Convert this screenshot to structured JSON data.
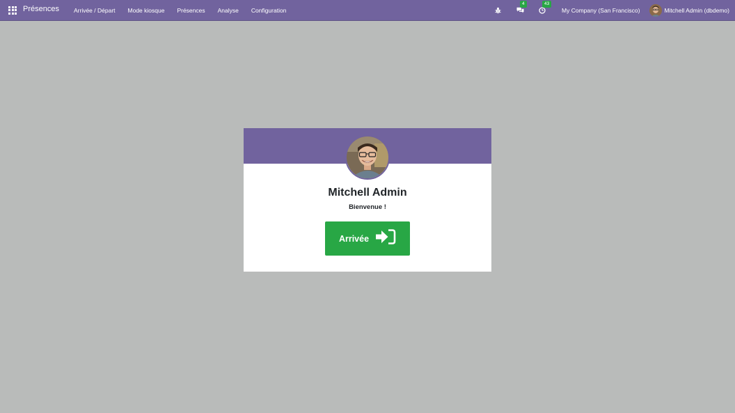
{
  "navbar": {
    "brand": "Présences",
    "menu": [
      {
        "label": "Arrivée / Départ"
      },
      {
        "label": "Mode kiosque"
      },
      {
        "label": "Présences"
      },
      {
        "label": "Analyse"
      },
      {
        "label": "Configuration"
      }
    ],
    "icons": {
      "debug": "bug-icon",
      "messages": "chat-icon",
      "activities": "clock-icon"
    },
    "messages_badge": "4",
    "activities_badge": "43",
    "company": "My Company (San Francisco)",
    "user_name": "Mitchell Admin (dbdemo)"
  },
  "card": {
    "employee_name": "Mitchell Admin",
    "welcome": "Bienvenue !",
    "checkin_label": "Arrivée",
    "checkin_icon": "sign-in-icon"
  },
  "colors": {
    "brand": "#71639e",
    "background": "#b9bbba",
    "success": "#28a745",
    "badge": "#28a745"
  }
}
